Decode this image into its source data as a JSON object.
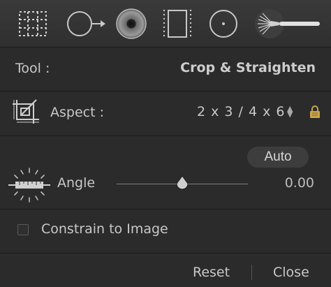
{
  "toolstrip": {
    "tools": [
      {
        "icon": "crop-overlay-icon"
      },
      {
        "icon": "spot-removal-icon"
      },
      {
        "icon": "red-eye-icon"
      },
      {
        "icon": "graduated-filter-icon"
      },
      {
        "icon": "radial-filter-icon"
      },
      {
        "icon": "adjustment-brush-icon"
      }
    ]
  },
  "panel": {
    "tool_label": "Tool :",
    "tool_value": "Crop & Straighten",
    "aspect_label": "Aspect :",
    "aspect_value": "2 x 3  /  4 x 6",
    "auto_label": "Auto",
    "angle_label": "Angle",
    "angle_value": "0.00",
    "angle_slider_value": 0,
    "angle_slider_range": [
      -45,
      45
    ],
    "constrain_label": "Constrain to Image",
    "constrain_checked": false,
    "reset_label": "Reset",
    "close_label": "Close"
  },
  "colors": {
    "background": "#2b2b2b",
    "text": "#c8c8c8",
    "lock": "#c9a64a"
  }
}
